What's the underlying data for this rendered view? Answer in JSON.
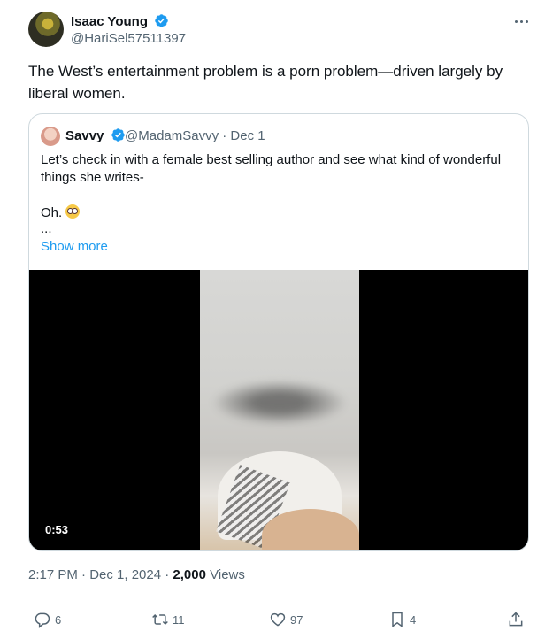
{
  "author": {
    "name": "Isaac Young",
    "handle": "@HariSel57511397"
  },
  "tweet": {
    "text": "The West’s entertainment problem is a porn problem—driven largely by liberal women."
  },
  "quote": {
    "name": "Savvy",
    "handle_date": "@MadamSavvy · Dec 1",
    "text": "Let’s check in with a female best selling author and see what kind of wonderful things she writes-",
    "line3": "Oh.",
    "ellipsis": "...",
    "show_more": "Show more",
    "video_duration": "0:53"
  },
  "meta": {
    "time_date": "2:17 PM · Dec 1, 2024 · ",
    "views_count": "2,000",
    "views_label": " Views"
  },
  "actions": {
    "replies": "6",
    "reposts": "11",
    "likes": "97",
    "bookmarks": "4"
  },
  "colors": {
    "accent": "#1d9bf0",
    "text": "#0f1419",
    "secondary": "#536471",
    "border": "#cfd9de"
  },
  "icons": [
    "verified-badge-icon",
    "more-icon",
    "reply-icon",
    "repost-icon",
    "like-icon",
    "bookmark-icon",
    "share-icon",
    "flushed-face-emoji"
  ]
}
